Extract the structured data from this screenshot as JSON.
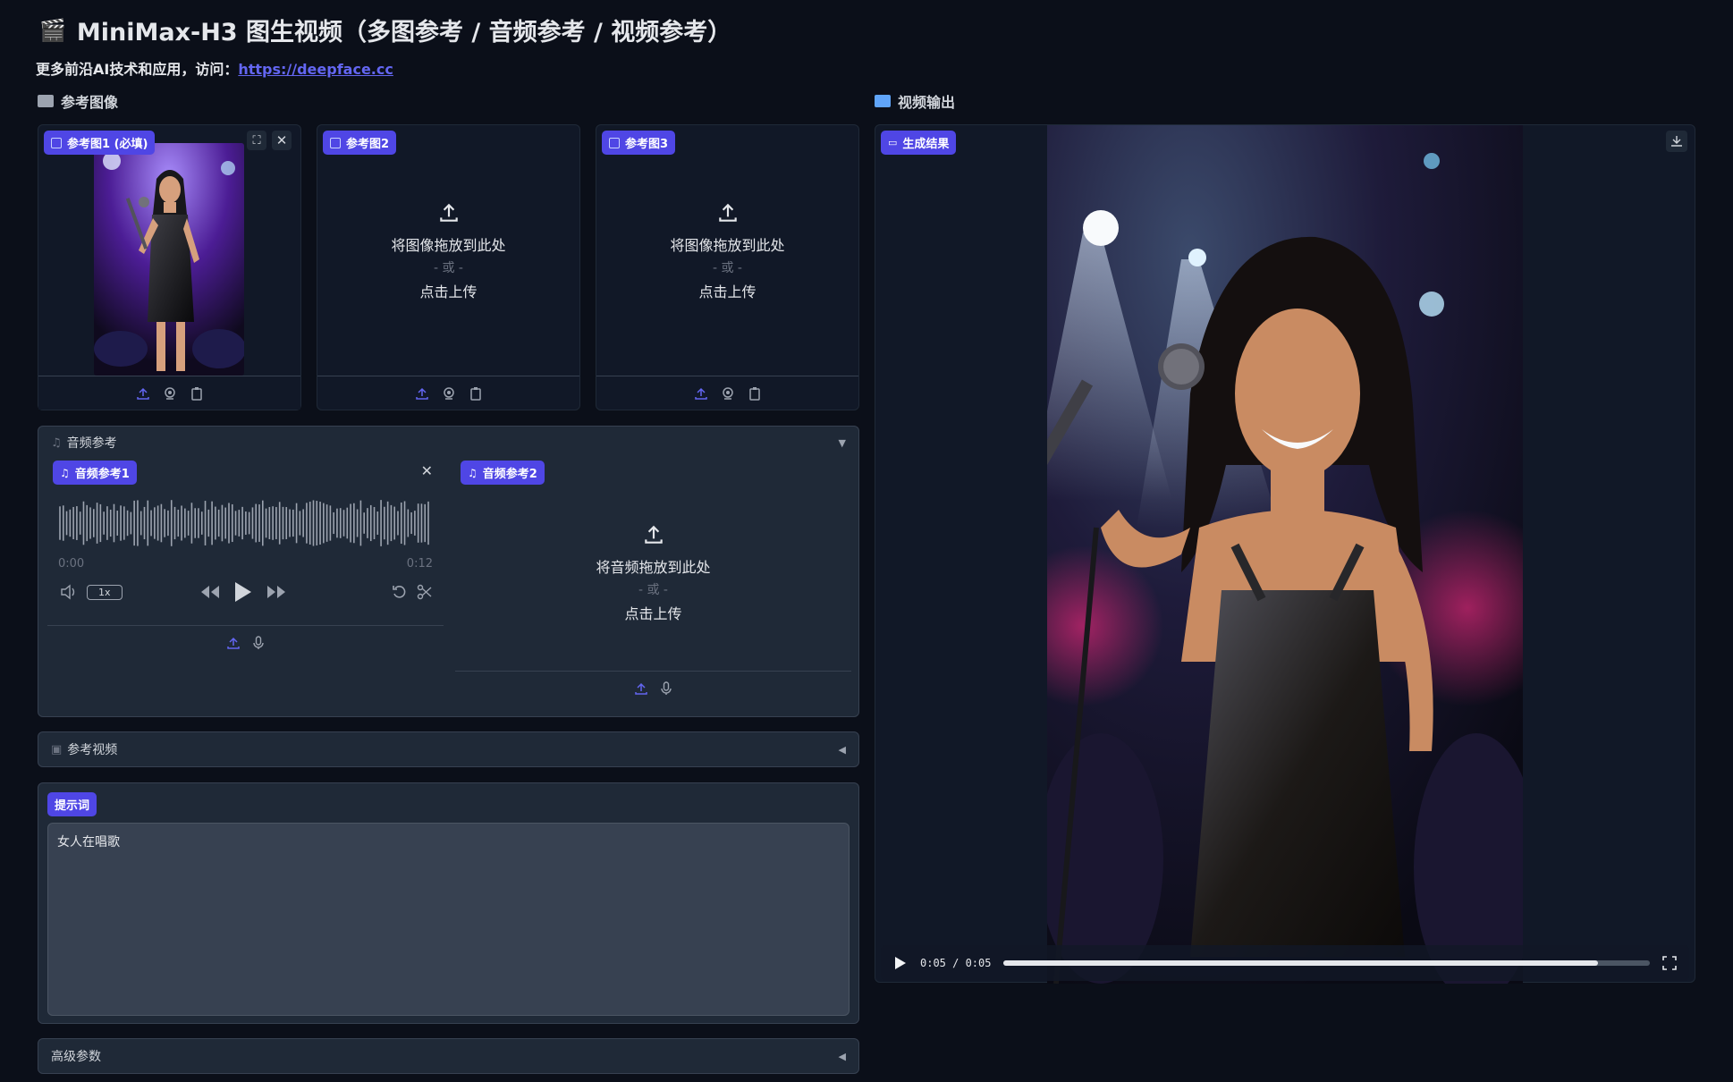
{
  "app": {
    "title": "MiniMax-H3 图生视频（多图参考 / 音频参考 / 视频参考）",
    "subtitle_prefix": "更多前沿AI技术和应用，访问：",
    "subtitle_link": "https://deepface.cc"
  },
  "left": {
    "section_title": "参考图像",
    "images": [
      {
        "badge": "参考图1 (必填)"
      },
      {
        "badge": "参考图2",
        "drop": "将图像拖放到此处",
        "or": "- 或 -",
        "click": "点击上传"
      },
      {
        "badge": "参考图3",
        "drop": "将图像拖放到此处",
        "or": "- 或 -",
        "click": "点击上传"
      }
    ],
    "audio": {
      "header": "音频参考",
      "ref1_badge": "音频参考1",
      "time_start": "0:00",
      "time_end": "0:12",
      "speed": "1x",
      "ref2_badge": "音频参考2",
      "drop": "将音频拖放到此处",
      "or": "- 或 -",
      "click": "点击上传"
    },
    "video_ref_header": "参考视频",
    "prompt": {
      "badge": "提示词",
      "value": "女人在唱歌"
    },
    "advanced_header": "高级参数"
  },
  "right": {
    "section_title": "视频输出",
    "badge": "生成结果",
    "time": "0:05 / 0:05",
    "progress": 0.92
  },
  "colors": {
    "accent": "#4f46e5",
    "link": "#6366f1",
    "background": "#0b0f19",
    "panel": "#1f2937"
  }
}
